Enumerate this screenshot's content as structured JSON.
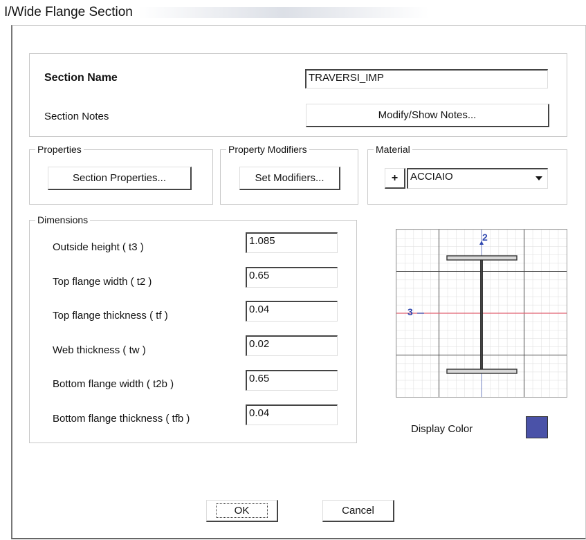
{
  "window": {
    "title": "I/Wide Flange Section"
  },
  "section": {
    "name_label": "Section Name",
    "name_value": "TRAVERSI_IMP",
    "notes_label": "Section Notes",
    "notes_button": "Modify/Show Notes..."
  },
  "properties": {
    "group_label": "Properties",
    "button": "Section Properties..."
  },
  "modifiers": {
    "group_label": "Property Modifiers",
    "button": "Set Modifiers..."
  },
  "material": {
    "group_label": "Material",
    "plus_button": "+",
    "selected": "ACCIAIO"
  },
  "dimensions": {
    "group_label": "Dimensions",
    "rows": [
      {
        "label": "Outside height  ( t3 )",
        "value": "1.085"
      },
      {
        "label": "Top flange width  ( t2 )",
        "value": "0.65"
      },
      {
        "label": "Top flange thickness  ( tf )",
        "value": "0.04"
      },
      {
        "label": "Web thickness  ( tw )",
        "value": "0.02"
      },
      {
        "label": "Bottom flange width  ( t2b )",
        "value": "0.65"
      },
      {
        "label": "Bottom flange thickness  ( tfb )",
        "value": "0.04"
      }
    ]
  },
  "preview": {
    "axis_2": "2",
    "axis_3": "3"
  },
  "display_color": {
    "label": "Display Color",
    "color": "#4a52a8"
  },
  "footer": {
    "ok": "OK",
    "cancel": "Cancel"
  }
}
